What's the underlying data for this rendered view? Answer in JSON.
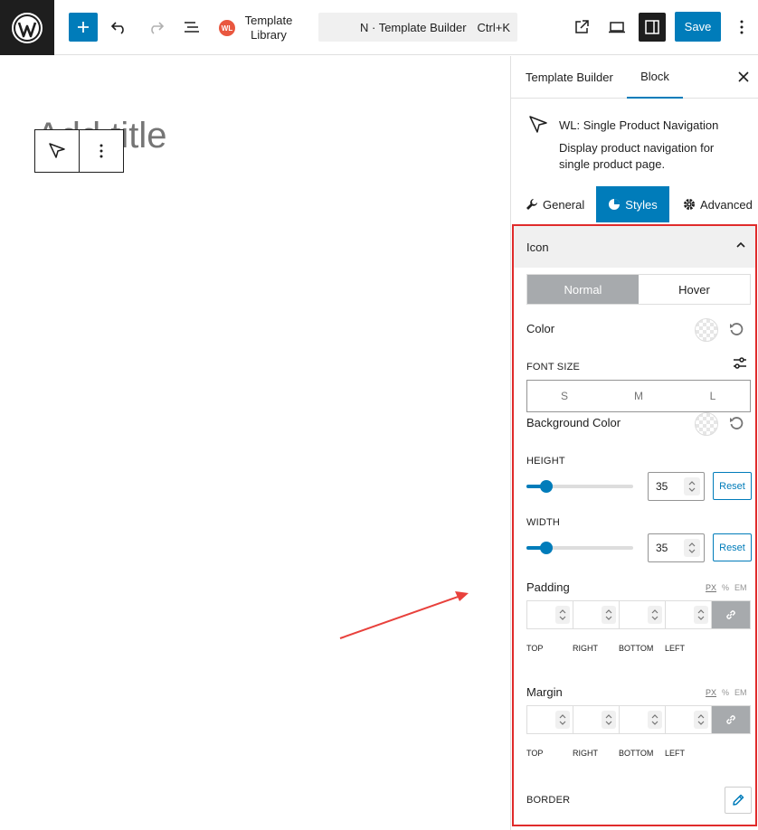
{
  "header": {
    "template_library_label": "Template Library",
    "template_badge": "WL",
    "command_text": "N · Template Builder",
    "command_shortcut": "Ctrl+K",
    "save_label": "Save"
  },
  "canvas": {
    "title_placeholder": "Add title"
  },
  "sidebar": {
    "tabs": [
      {
        "label": "Template Builder"
      },
      {
        "label": "Block"
      }
    ],
    "block": {
      "title": "WL: Single Product Navigation",
      "description": "Display product navigation for single product page."
    },
    "mode_tabs": [
      {
        "label": "General"
      },
      {
        "label": "Styles"
      },
      {
        "label": "Advanced"
      }
    ],
    "panel": {
      "title": "Icon",
      "state_options": [
        "Normal",
        "Hover"
      ],
      "color_label": "Color",
      "font_size_label": "FONT SIZE",
      "font_sizes": [
        "S",
        "M",
        "L"
      ],
      "background_color_label": "Background Color",
      "height": {
        "label": "HEIGHT",
        "value": "35",
        "reset": "Reset",
        "slider_fraction": 0.19
      },
      "width": {
        "label": "WIDTH",
        "value": "35",
        "reset": "Reset",
        "slider_fraction": 0.19
      },
      "padding": {
        "label": "Padding",
        "units": [
          "PX",
          "%",
          "EM"
        ],
        "sides": [
          "TOP",
          "RIGHT",
          "BOTTOM",
          "LEFT"
        ]
      },
      "margin": {
        "label": "Margin",
        "units": [
          "PX",
          "%",
          "EM"
        ],
        "sides": [
          "TOP",
          "RIGHT",
          "BOTTOM",
          "LEFT"
        ]
      },
      "border_label": "BORDER"
    }
  },
  "colors": {
    "accent": "#007cba",
    "highlight_border": "#e02b2b",
    "annotation_arrow": "#e8413c"
  },
  "icons": [
    "wordpress-logo",
    "plus-icon",
    "undo-icon",
    "redo-icon",
    "list-view-icon",
    "external-link-icon",
    "desktop-icon",
    "sidebar-toggle-icon",
    "more-vertical-icon",
    "close-icon",
    "pointer-icon",
    "wrench-icon",
    "styles-icon",
    "gear-icon",
    "chevron-up-icon",
    "reset-icon",
    "adjust-icon",
    "link-icon",
    "pencil-icon"
  ]
}
